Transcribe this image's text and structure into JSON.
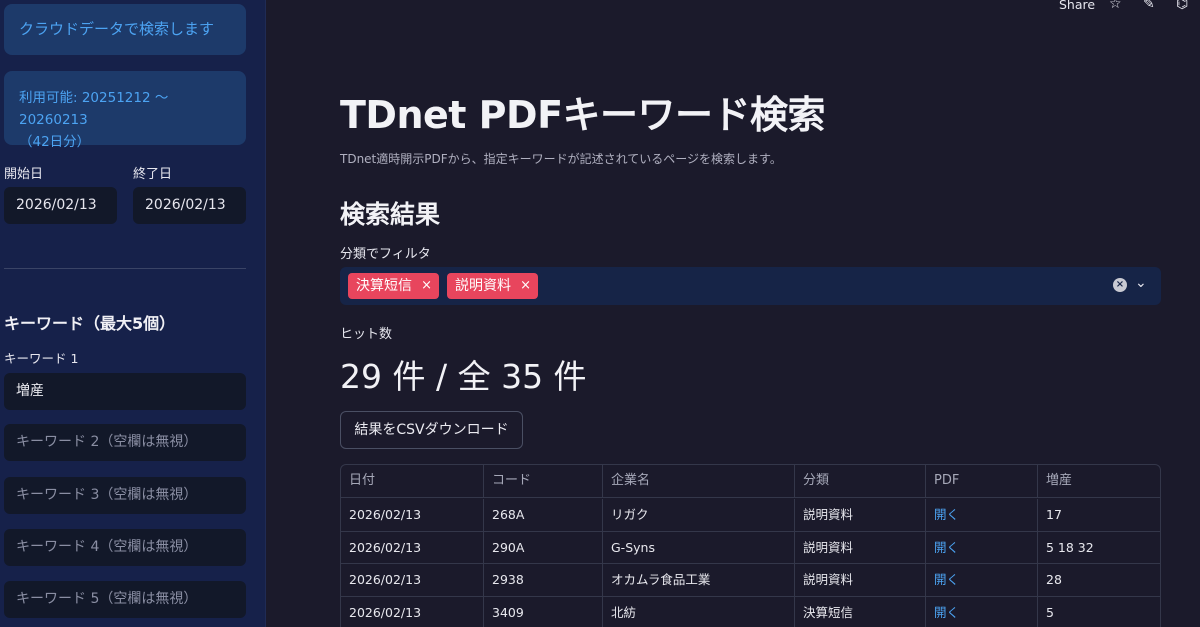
{
  "sidebar": {
    "cloud_button": "クラウドデータで検索します",
    "info_line1": "利用可能: 20251212 〜 20260213",
    "info_line2": "（42日分）",
    "start_label": "開始日",
    "end_label": "終了日",
    "start_value": "2026/02/13",
    "end_value": "2026/02/13",
    "keywords_heading": "キーワード（最大5個）",
    "keyword1_label": "キーワード 1",
    "keyword1_value": "増産",
    "keyword2_placeholder": "キーワード 2（空欄は無視）",
    "keyword3_placeholder": "キーワード 3（空欄は無視）",
    "keyword4_placeholder": "キーワード 4（空欄は無視）",
    "keyword5_placeholder": "キーワード 5（空欄は無視）"
  },
  "toolbar": {
    "share_label": "Share",
    "star_icon": "☆",
    "edit_icon": "✎",
    "github_icon": "⌬"
  },
  "main": {
    "title": "TDnet PDFキーワード検索",
    "subtitle": "TDnet適時開示PDFから、指定キーワードが記述されているページを検索します。",
    "results_heading": "検索結果",
    "filter_label": "分類でフィルタ",
    "chips": [
      "決算短信",
      "説明資料"
    ],
    "chip_remove": "×",
    "hits_label": "ヒット数",
    "hits_value": "29 件 / 全 35 件",
    "csv_button": "結果をCSVダウンロード"
  },
  "table": {
    "headers": [
      "日付",
      "コード",
      "企業名",
      "分類",
      "PDF",
      "増産"
    ],
    "rows": [
      [
        "2026/02/13",
        "268A",
        "リガク",
        "説明資料",
        "開く",
        "17"
      ],
      [
        "2026/02/13",
        "290A",
        "G-Syns",
        "説明資料",
        "開く",
        "5 18 32"
      ],
      [
        "2026/02/13",
        "2938",
        "オカムラ食品工業",
        "説明資料",
        "開く",
        "28"
      ],
      [
        "2026/02/13",
        "3409",
        "北紡",
        "決算短信",
        "開く",
        "5"
      ]
    ]
  },
  "colors": {
    "chip": "#e8455d",
    "link": "#4ca3f2",
    "sidebar_bg": "#16214a",
    "main_bg": "#1b1a2b"
  }
}
